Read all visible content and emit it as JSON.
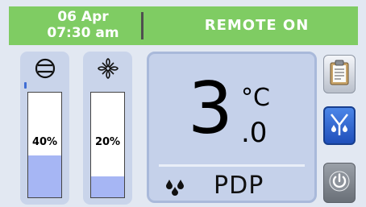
{
  "header": {
    "date": "06 Apr",
    "time": "07:30 am",
    "status": "REMOTE ON"
  },
  "gauges": [
    {
      "icon": "compressor-icon",
      "value": 40,
      "label": "40%"
    },
    {
      "icon": "fan-icon",
      "value": 20,
      "label": "20%"
    }
  ],
  "display": {
    "integer": "3",
    "unit": "°C",
    "decimal": ".0",
    "mode_icon": "water-drops-icon",
    "mode": "PDP"
  },
  "side_buttons": [
    {
      "icon": "clipboard-icon"
    },
    {
      "icon": "drain-icon"
    },
    {
      "icon": "power-icon"
    }
  ],
  "colors": {
    "header_bg": "#7fcc63",
    "gauge_fill": "#a6b6f4",
    "panel_bg": "#c9d4ea",
    "drain_button": "#2e64d2"
  }
}
